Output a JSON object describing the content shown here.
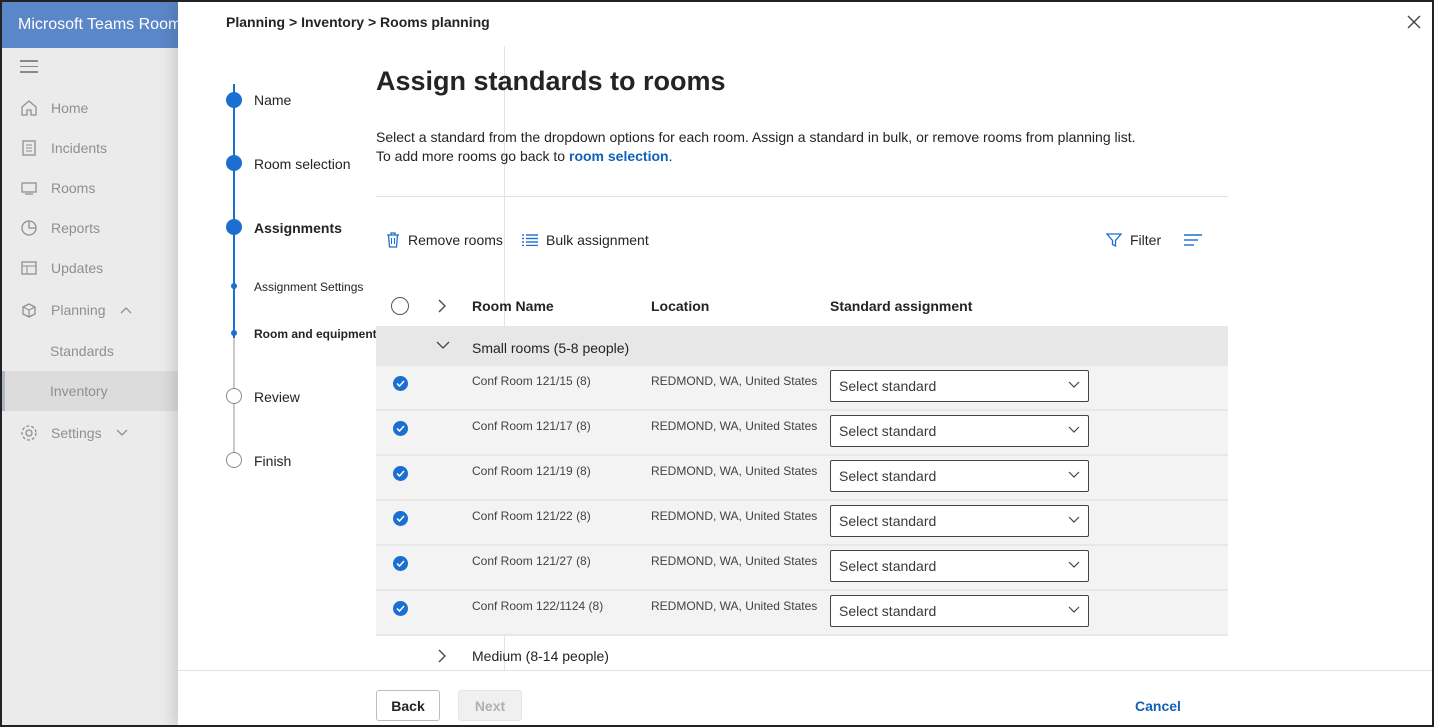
{
  "app": {
    "title": "Microsoft Teams Rooms"
  },
  "nav": {
    "items": [
      {
        "label": "Home",
        "icon": "home-icon"
      },
      {
        "label": "Incidents",
        "icon": "incidents-icon"
      },
      {
        "label": "Rooms",
        "icon": "rooms-icon"
      },
      {
        "label": "Reports",
        "icon": "reports-icon"
      },
      {
        "label": "Updates",
        "icon": "updates-icon"
      },
      {
        "label": "Planning",
        "icon": "planning-icon"
      },
      {
        "label": "Standards"
      },
      {
        "label": "Inventory"
      },
      {
        "label": "Settings",
        "icon": "settings-icon"
      }
    ]
  },
  "breadcrumb": "Planning > Inventory > Rooms planning",
  "stepper": {
    "steps": [
      "Name",
      "Room selection",
      "Assignments",
      "Assignment Settings",
      "Room and equipment assignments",
      "Review",
      "Finish"
    ]
  },
  "main": {
    "title": "Assign standards to rooms",
    "desc_line1": "Select a standard from the dropdown options for each room. Assign a standard in bulk, or remove rooms from planning list.",
    "desc_line2_prefix": "To add more rooms go back to ",
    "desc_link": "room selection",
    "desc_suffix": "."
  },
  "toolbar": {
    "remove_label": "Remove rooms",
    "bulk_label": "Bulk assignment",
    "filter_label": "Filter"
  },
  "table": {
    "columns": [
      "Room Name",
      "Location",
      "Standard assignment"
    ],
    "group1": "Small rooms (5-8 people)",
    "rows": [
      {
        "name": "Conf Room 121/15 (8)",
        "location": "REDMOND, WA, United States",
        "standard": "Select standard"
      },
      {
        "name": "Conf Room 121/17 (8)",
        "location": "REDMOND, WA, United States",
        "standard": "Select standard"
      },
      {
        "name": "Conf Room 121/19 (8)",
        "location": "REDMOND, WA, United States",
        "standard": "Select standard"
      },
      {
        "name": "Conf Room 121/22 (8)",
        "location": "REDMOND, WA, United States",
        "standard": "Select standard"
      },
      {
        "name": "Conf Room 121/27 (8)",
        "location": "REDMOND, WA, United States",
        "standard": "Select standard"
      },
      {
        "name": "Conf Room 122/1124 (8)",
        "location": "REDMOND, WA, United States",
        "standard": "Select standard"
      }
    ],
    "group2": "Medium (8-14 people)"
  },
  "footer": {
    "back": "Back",
    "next": "Next",
    "cancel": "Cancel"
  },
  "colors": {
    "accent": "#1a6fd1",
    "header": "#5b87c9",
    "link": "#1260b7"
  }
}
